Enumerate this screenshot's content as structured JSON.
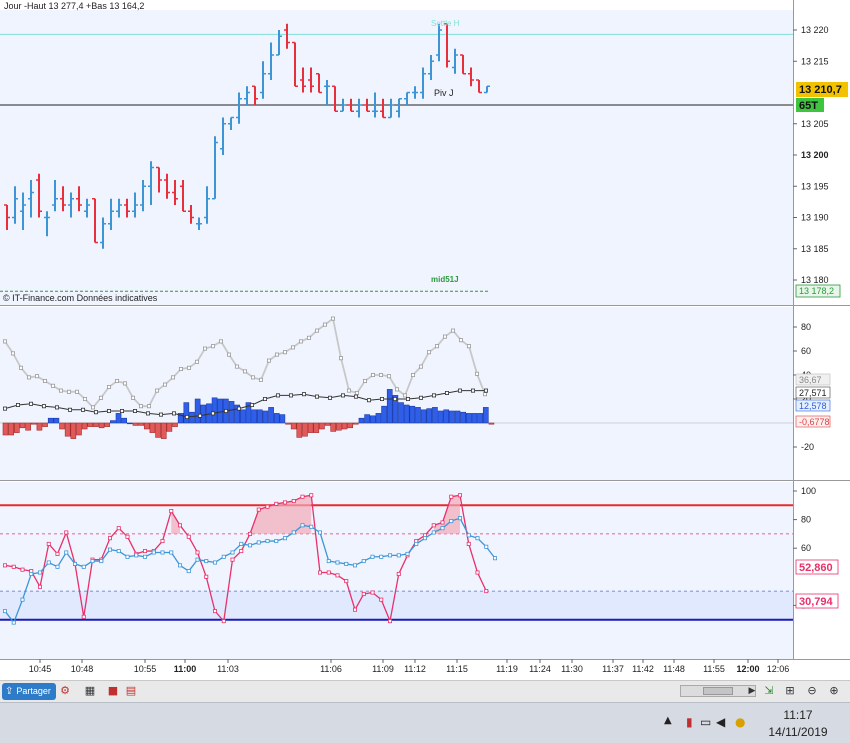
{
  "header": {
    "label": "Jour  -Haut 13 277,4 +Bas 13 164,2"
  },
  "price_pane": {
    "copyright": "© IT-Finance.com  Données indicatives",
    "settle_label": "Settle H",
    "piv_label": "Piv J",
    "mid_label": "mid51J",
    "current_price": "13 210,7",
    "time_left": "65T",
    "mid_price": "13 178,2",
    "ticks": [
      "13 220",
      "13 215",
      "13 205",
      "13 200",
      "13 195",
      "13 190",
      "13 185",
      "13 180"
    ],
    "bold_tick": "13 200",
    "colors": {
      "up": "#3d95d6",
      "down": "#e8303c",
      "settle": "#7fe0d8",
      "pivot": "#222222",
      "mid": "#2a9a3a"
    }
  },
  "osc1_pane": {
    "ticks": [
      "80",
      "60",
      "40",
      "20",
      "-20"
    ],
    "values": [
      "36,67",
      "27,571",
      "12,578",
      "-0,6778"
    ]
  },
  "osc2_pane": {
    "ticks": [
      "100",
      "80",
      "60",
      "20"
    ],
    "values": [
      "52,860",
      "30,794"
    ]
  },
  "x_axis": {
    "ticks": [
      "10:45",
      "10:48",
      "10:55",
      "11:00",
      "11:03",
      "11:06",
      "11:09",
      "11:12",
      "11:15",
      "11:19",
      "11:24",
      "11:30",
      "11:37",
      "11:42",
      "11:48",
      "11:55",
      "12:00",
      "12:06"
    ]
  },
  "toolbar": {
    "share_label": "Partager"
  },
  "taskbar": {
    "time": "11:17",
    "date": "14/11/2019"
  },
  "chart_data": [
    {
      "type": "ohlc",
      "title": "",
      "ylim": [
        13178,
        13223
      ],
      "y_ticks": [
        13220,
        13215,
        13205,
        13200,
        13195,
        13190,
        13185,
        13180
      ],
      "bars": [
        {
          "o": 13192,
          "h": 13192,
          "l": 13188,
          "c": 13190
        },
        {
          "o": 13190,
          "h": 13195,
          "l": 13189,
          "c": 13193
        },
        {
          "o": 13191,
          "h": 13194,
          "l": 13188,
          "c": 13192
        },
        {
          "o": 13193,
          "h": 13196,
          "l": 13190,
          "c": 13194
        },
        {
          "o": 13196,
          "h": 13197,
          "l": 13190,
          "c": 13191
        },
        {
          "o": 13190,
          "h": 13191,
          "l": 13187,
          "c": 13190
        },
        {
          "o": 13192,
          "h": 13196,
          "l": 13191,
          "c": 13193
        },
        {
          "o": 13193,
          "h": 13195,
          "l": 13191,
          "c": 13192
        },
        {
          "o": 13192,
          "h": 13194,
          "l": 13190,
          "c": 13193
        },
        {
          "o": 13193,
          "h": 13195,
          "l": 13191,
          "c": 13192
        },
        {
          "o": 13191,
          "h": 13193,
          "l": 13190,
          "c": 13192
        },
        {
          "o": 13193,
          "h": 13193,
          "l": 13186,
          "c": 13186
        },
        {
          "o": 13186,
          "h": 13190,
          "l": 13185,
          "c": 13189
        },
        {
          "o": 13189,
          "h": 13193,
          "l": 13188,
          "c": 13191
        },
        {
          "o": 13191,
          "h": 13193,
          "l": 13190,
          "c": 13192
        },
        {
          "o": 13192,
          "h": 13193,
          "l": 13190,
          "c": 13191
        },
        {
          "o": 13191,
          "h": 13194,
          "l": 13190,
          "c": 13192
        },
        {
          "o": 13192,
          "h": 13196,
          "l": 13191,
          "c": 13195
        },
        {
          "o": 13195,
          "h": 13199,
          "l": 13192,
          "c": 13198
        },
        {
          "o": 13198,
          "h": 13198,
          "l": 13194,
          "c": 13196
        },
        {
          "o": 13196,
          "h": 13197,
          "l": 13193,
          "c": 13194
        },
        {
          "o": 13194,
          "h": 13196,
          "l": 13192,
          "c": 13193
        },
        {
          "o": 13195,
          "h": 13196,
          "l": 13191,
          "c": 13191
        },
        {
          "o": 13191,
          "h": 13192,
          "l": 13189,
          "c": 13190
        },
        {
          "o": 13189,
          "h": 13190,
          "l": 13188,
          "c": 13189
        },
        {
          "o": 13190,
          "h": 13195,
          "l": 13189,
          "c": 13193
        },
        {
          "o": 13193,
          "h": 13203,
          "l": 13193,
          "c": 13202
        },
        {
          "o": 13201,
          "h": 13206,
          "l": 13200,
          "c": 13205
        },
        {
          "o": 13205,
          "h": 13206,
          "l": 13204,
          "c": 13206
        },
        {
          "o": 13206,
          "h": 13210,
          "l": 13205,
          "c": 13209
        },
        {
          "o": 13209,
          "h": 13211,
          "l": 13208,
          "c": 13210
        },
        {
          "o": 13211,
          "h": 13211,
          "l": 13208,
          "c": 13209
        },
        {
          "o": 13210,
          "h": 13215,
          "l": 13209,
          "c": 13213
        },
        {
          "o": 13213,
          "h": 13218,
          "l": 13212,
          "c": 13216
        },
        {
          "o": 13216,
          "h": 13220,
          "l": 13216,
          "c": 13219
        },
        {
          "o": 13220,
          "h": 13221,
          "l": 13217,
          "c": 13218
        },
        {
          "o": 13218,
          "h": 13218,
          "l": 13211,
          "c": 13211
        },
        {
          "o": 13212,
          "h": 13214,
          "l": 13210,
          "c": 13211
        },
        {
          "o": 13212,
          "h": 13214,
          "l": 13210,
          "c": 13211
        },
        {
          "o": 13213,
          "h": 13213,
          "l": 13210,
          "c": 13210
        },
        {
          "o": 13211,
          "h": 13212,
          "l": 13208,
          "c": 13211
        },
        {
          "o": 13211,
          "h": 13211,
          "l": 13207,
          "c": 13207
        },
        {
          "o": 13207,
          "h": 13209,
          "l": 13207,
          "c": 13208
        },
        {
          "o": 13208,
          "h": 13209,
          "l": 13207,
          "c": 13207
        },
        {
          "o": 13207,
          "h": 13209,
          "l": 13206,
          "c": 13208
        },
        {
          "o": 13208,
          "h": 13209,
          "l": 13207,
          "c": 13207
        },
        {
          "o": 13207,
          "h": 13210,
          "l": 13206,
          "c": 13207
        },
        {
          "o": 13207,
          "h": 13209,
          "l": 13206,
          "c": 13206
        },
        {
          "o": 13206,
          "h": 13209,
          "l": 13206,
          "c": 13208
        },
        {
          "o": 13207,
          "h": 13209,
          "l": 13206,
          "c": 13209
        },
        {
          "o": 13209,
          "h": 13210,
          "l": 13208,
          "c": 13210
        },
        {
          "o": 13210,
          "h": 13211,
          "l": 13209,
          "c": 13210
        },
        {
          "o": 13210,
          "h": 13214,
          "l": 13209,
          "c": 13213
        },
        {
          "o": 13213,
          "h": 13216,
          "l": 13212,
          "c": 13215
        },
        {
          "o": 13216,
          "h": 13221,
          "l": 13215,
          "c": 13220
        },
        {
          "o": 13221,
          "h": 13221,
          "l": 13214,
          "c": 13215
        },
        {
          "o": 13214,
          "h": 13217,
          "l": 13213,
          "c": 13216
        },
        {
          "o": 13216,
          "h": 13216,
          "l": 13213,
          "c": 13213
        },
        {
          "o": 13213,
          "h": 13214,
          "l": 13211,
          "c": 13212
        },
        {
          "o": 13212,
          "h": 13212,
          "l": 13210,
          "c": 13210
        },
        {
          "o": 13210,
          "h": 13211,
          "l": 13210,
          "c": 13211
        }
      ],
      "levels": {
        "settle": 13219.3,
        "pivot": 13208.0,
        "mid": 13178.2
      }
    },
    {
      "type": "bar+line",
      "ylim": [
        -38,
        92
      ],
      "y_ticks": [
        80,
        60,
        40,
        20,
        -20
      ],
      "histogram": [
        -10,
        -10,
        -8,
        -4,
        -6,
        -1,
        -6,
        -3,
        4,
        4,
        -5,
        -11,
        -13,
        -10,
        -5,
        -3,
        -3,
        -4,
        -3,
        2,
        8,
        4,
        0,
        -2,
        -2,
        -5,
        -8,
        -12,
        -13,
        -7,
        -3,
        8,
        17,
        9,
        20,
        15,
        16,
        21,
        20,
        20,
        18,
        15,
        11,
        17,
        11,
        11,
        10,
        13,
        8,
        7,
        -1,
        -5,
        -12,
        -11,
        -8,
        -8,
        -5,
        -2,
        -7,
        -6,
        -5,
        -4,
        -1,
        4,
        7,
        6,
        8,
        14,
        28,
        23,
        17,
        15,
        14,
        13,
        11,
        12,
        13,
        10,
        11,
        10,
        10,
        9,
        8,
        8,
        8,
        13,
        -1
      ],
      "line_gray": [
        68,
        58,
        46,
        38,
        39,
        35,
        31,
        27,
        26,
        26,
        20,
        13,
        21,
        30,
        35,
        33,
        21,
        14,
        14,
        27,
        32,
        38,
        45,
        46,
        51,
        62,
        64,
        68,
        57,
        47,
        43,
        38,
        36,
        52,
        57,
        59,
        63,
        68,
        71,
        77,
        82,
        87,
        54,
        27,
        25,
        35,
        40,
        40,
        39,
        28,
        23,
        40,
        47,
        59,
        64,
        72,
        77,
        69,
        64,
        41,
        24
      ],
      "line_black": [
        12,
        15,
        16,
        14,
        13,
        11,
        11,
        9,
        10,
        10,
        10,
        8,
        7,
        8,
        5,
        6,
        8,
        10,
        12,
        15,
        20,
        23,
        23,
        24,
        22,
        21,
        23,
        22,
        19,
        20,
        20,
        20,
        21,
        23,
        25,
        27,
        27,
        27
      ]
    },
    {
      "type": "line",
      "ylim": [
        -3,
        103
      ],
      "y_ticks": [
        100,
        80,
        60,
        20
      ],
      "levels": {
        "upper": 90,
        "upper_dash": 70,
        "lower_dash": 30,
        "lower": 10
      },
      "stoch_fast": [
        48,
        47,
        45,
        44,
        33,
        63,
        56,
        71,
        49,
        12,
        52,
        52,
        67,
        74,
        68,
        56,
        58,
        58,
        65,
        86,
        76,
        68,
        57,
        40,
        16,
        9,
        52,
        58,
        70,
        87,
        89,
        91,
        92,
        93,
        96,
        97,
        43,
        43,
        41,
        37,
        17,
        28,
        29,
        24,
        9,
        42,
        55,
        65,
        69,
        76,
        78,
        96,
        97,
        63,
        43,
        30
      ],
      "stoch_slow": [
        16,
        8,
        24,
        42,
        43,
        50,
        47,
        57,
        49,
        47,
        51,
        51,
        59,
        58,
        54,
        55,
        54,
        57,
        57,
        57,
        48,
        44,
        52,
        51,
        50,
        54,
        57,
        63,
        62,
        64,
        65,
        65,
        67,
        71,
        76,
        75,
        71,
        51,
        50,
        49,
        48,
        51,
        54,
        54,
        55,
        55,
        56,
        63,
        67,
        71,
        74,
        79,
        81,
        69,
        67,
        61,
        53
      ]
    }
  ]
}
